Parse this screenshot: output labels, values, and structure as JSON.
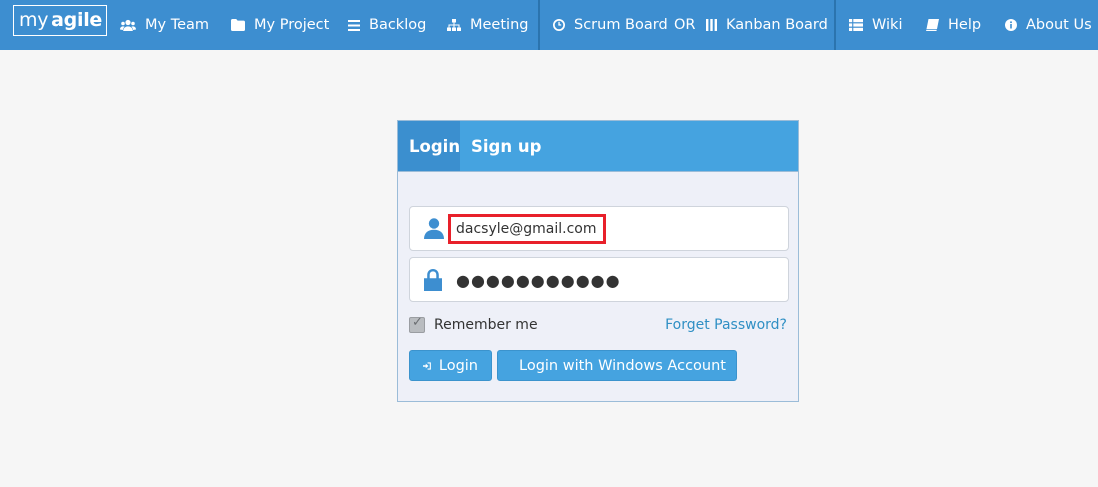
{
  "brand": {
    "prefix": "my",
    "name": "agile"
  },
  "nav": {
    "my_team": "My Team",
    "my_project": "My Project",
    "backlog": "Backlog",
    "meeting": "Meeting",
    "scrum_board": "Scrum Board",
    "or": "OR",
    "kanban_board": "Kanban Board",
    "wiki": "Wiki",
    "help": "Help",
    "about_us": "About Us"
  },
  "tabs": {
    "login": "Login",
    "signup": "Sign up"
  },
  "form": {
    "email_value": "dacsyle@gmail.com",
    "password_value": "●●●●●●●●●●●",
    "remember_label": "Remember me",
    "remember_checked": true,
    "forgot_label": "Forget Password?",
    "login_button": "Login",
    "windows_button": "Login with Windows Account"
  },
  "colors": {
    "navbar": "#3d8ed0",
    "tabbar": "#45a3e0",
    "highlight": "#e8202a",
    "link": "#2f8fc4"
  }
}
